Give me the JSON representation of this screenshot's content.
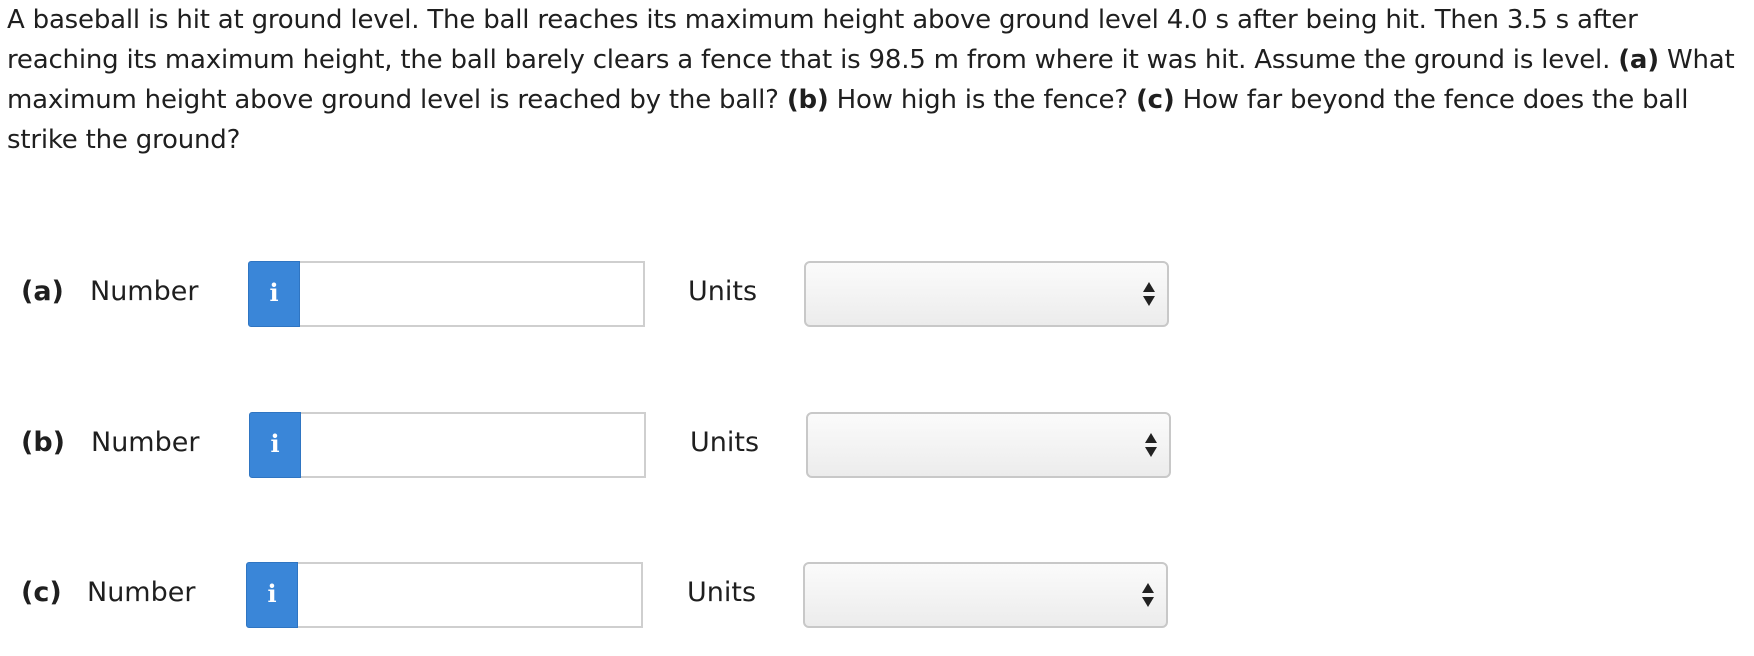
{
  "question": {
    "intro": "A baseball is hit at ground level. The ball reaches its maximum height above ground level 4.0 s after being hit. Then 3.5 s after reaching its maximum height, the ball barely clears a fence that is 98.5 m from where it was hit. Assume the ground is level. ",
    "part_a_tag": "(a)",
    "part_a_text": " What maximum height above ground level is reached by the ball? ",
    "part_b_tag": "(b)",
    "part_b_text": " How high is the fence? ",
    "part_c_tag": "(c)",
    "part_c_text": " How far beyond the fence does the ball strike the ground?"
  },
  "answers": [
    {
      "part_label": "(a)",
      "number_label": "Number",
      "info_icon": "i",
      "number_value": "",
      "units_label": "Units",
      "units_selected": ""
    },
    {
      "part_label": "(b)",
      "number_label": "Number",
      "info_icon": "i",
      "number_value": "",
      "units_label": "Units",
      "units_selected": ""
    },
    {
      "part_label": "(c)",
      "number_label": "Number",
      "info_icon": "i",
      "number_value": "",
      "units_label": "Units",
      "units_selected": ""
    }
  ],
  "colors": {
    "info_button": "#3a86d8",
    "text": "#1f1f1f"
  },
  "icons": {
    "info": "info-icon",
    "select_arrows": "up-down-arrows-icon"
  }
}
